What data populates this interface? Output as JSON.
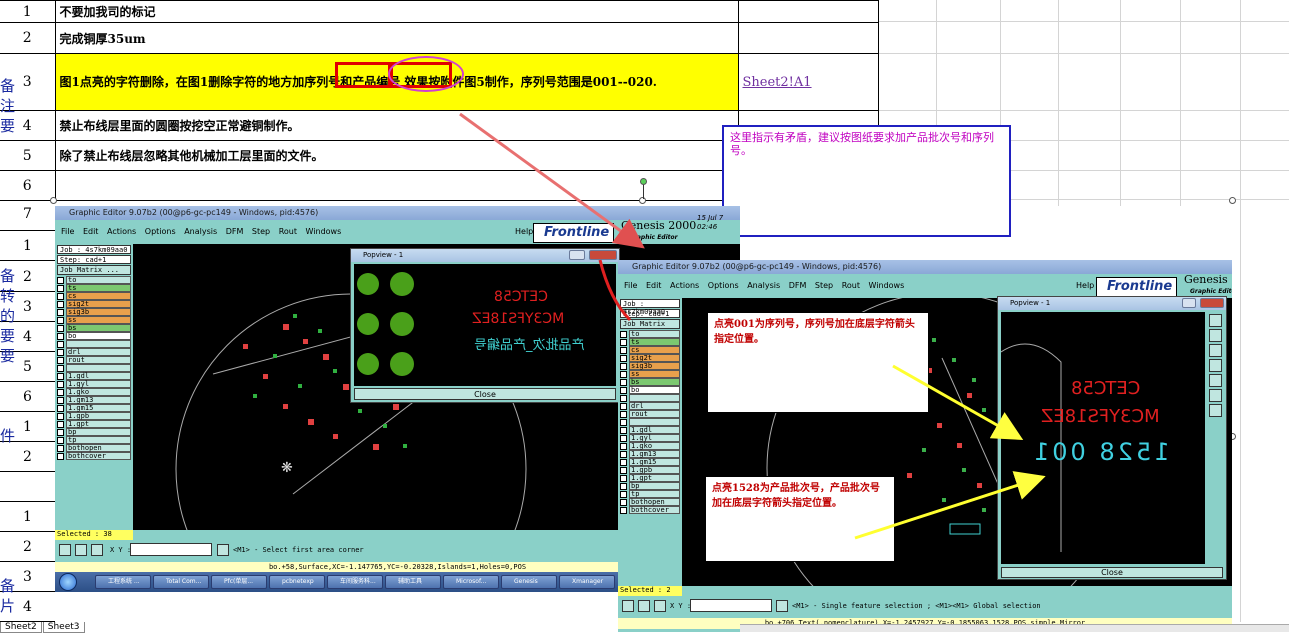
{
  "sheet": {
    "rows": [
      {
        "num": "1",
        "text": "不要加我司的标记",
        "link": ""
      },
      {
        "num": "2",
        "text": "完成铜厚35um",
        "link": ""
      },
      {
        "num": "3",
        "text": "图1点亮的字符删除，在图1删除字符的地方加序列号和产品编号 效果按附件图5制作，序列号范围是001--020.",
        "link": "Sheet2!A1",
        "highlight": true
      },
      {
        "num": "4",
        "text": "禁止布线层里面的圆圈按挖空正常避铜制作。",
        "link": ""
      },
      {
        "num": "5",
        "text": "除了禁止布线层忽略其他机械加工层里面的文件。",
        "link": ""
      },
      {
        "num": "6",
        "text": "",
        "link": ""
      },
      {
        "num": "7",
        "text": "",
        "link": ""
      }
    ],
    "lower_row_numbers": [
      "1",
      "2",
      "3",
      "4",
      "5",
      "6",
      "1",
      "2",
      "",
      "1",
      "2",
      "3",
      "4"
    ],
    "side_chars": [
      "备",
      "注",
      "要",
      "备",
      "转",
      "的",
      "要",
      "要",
      "件",
      "备",
      "片"
    ],
    "tabs": [
      "Sheet2",
      "Sheet3"
    ]
  },
  "comment": {
    "text": "这里指示有矛盾，建议按图纸要求加产品批次号和序列号。"
  },
  "win1": {
    "title": "Graphic Editor 9.07b2 (00@p6-gc-pc149 - Windows, pid:4576)",
    "menu": [
      "File",
      "Edit",
      "Actions",
      "Options",
      "Analysis",
      "DFM",
      "Step",
      "Rout",
      "Windows"
    ],
    "help": "Help",
    "logo": "Frontline",
    "app_name": "Genesis 2000",
    "app_sub": "Graphic Editor",
    "clock": "15 Jul 7 02:46",
    "job": "Job : 4s7km09aa0",
    "step": "Step: cad+1",
    "job_matrix": "Job Matrix ...",
    "layers": [
      {
        "name": "to",
        "style": ""
      },
      {
        "name": "ts",
        "style": "gr"
      },
      {
        "name": "cs",
        "style": "or"
      },
      {
        "name": "sig2t",
        "style": "or"
      },
      {
        "name": "sig3b",
        "style": "or"
      },
      {
        "name": "ss",
        "style": "or"
      },
      {
        "name": "bs",
        "style": "gr"
      },
      {
        "name": "bo",
        "style": "hi"
      },
      {
        "name": "",
        "style": ""
      },
      {
        "name": "drl",
        "style": ""
      },
      {
        "name": "rout",
        "style": ""
      },
      {
        "name": "",
        "style": ""
      },
      {
        "name": "1.gdl",
        "style": ""
      },
      {
        "name": "1.gyl",
        "style": ""
      },
      {
        "name": "1.gko",
        "style": ""
      },
      {
        "name": "1.gm13",
        "style": ""
      },
      {
        "name": "1.gm15",
        "style": ""
      },
      {
        "name": "1.gpb",
        "style": ""
      },
      {
        "name": "1.gpt",
        "style": ""
      },
      {
        "name": "bp",
        "style": ""
      },
      {
        "name": "tp",
        "style": ""
      },
      {
        "name": "bothopen",
        "style": ""
      },
      {
        "name": "bothcover",
        "style": ""
      }
    ],
    "selected": "Selected : 38",
    "xy_label": "X Y :",
    "hint": "<M1> - Select first area corner",
    "info": "bo.+58,Surface,XC=-1.147765,YC=-0.20328,Islands=1,Holes=0,POS"
  },
  "popview1": {
    "title": "Popview - 1",
    "text_lines": [
      "CETC58",
      "MC3YFS18EZ",
      "产品批次_产品编号"
    ],
    "close": "Close"
  },
  "win2": {
    "title": "Graphic Editor 9.07b2 (00@p6-gc-pc149 - Windows, pid:4576)",
    "menu": [
      "File",
      "Edit",
      "Actions",
      "Options",
      "Analysis",
      "DFM",
      "Step",
      "Rout",
      "Windows"
    ],
    "help": "Help",
    "logo": "Frontline",
    "app_name": "Genesis 20",
    "app_sub": "Graphic Editor",
    "job": "Job : 4s7km09aa0",
    "step": "Step: cad+1",
    "job_matrix": "Job Matrix ...",
    "layers": [
      {
        "name": "to",
        "style": ""
      },
      {
        "name": "ts",
        "style": "gr"
      },
      {
        "name": "cs",
        "style": "or"
      },
      {
        "name": "sig2t",
        "style": "or"
      },
      {
        "name": "sig3b",
        "style": "or"
      },
      {
        "name": "ss",
        "style": "or"
      },
      {
        "name": "bs",
        "style": "gr"
      },
      {
        "name": "bo",
        "style": "hi"
      },
      {
        "name": "",
        "style": ""
      },
      {
        "name": "drl",
        "style": ""
      },
      {
        "name": "rout",
        "style": ""
      },
      {
        "name": "",
        "style": ""
      },
      {
        "name": "1.gdl",
        "style": ""
      },
      {
        "name": "1.gyl",
        "style": ""
      },
      {
        "name": "1.gko",
        "style": ""
      },
      {
        "name": "1.gm13",
        "style": ""
      },
      {
        "name": "1.gm15",
        "style": ""
      },
      {
        "name": "1.gpb",
        "style": ""
      },
      {
        "name": "1.gpt",
        "style": ""
      },
      {
        "name": "bp",
        "style": ""
      },
      {
        "name": "tp",
        "style": ""
      },
      {
        "name": "bothopen",
        "style": ""
      },
      {
        "name": "bothcover",
        "style": ""
      }
    ],
    "selected": "Selected : 2",
    "xy_label": "X Y :",
    "hint": "<M1> - Single feature selection ; <M1><M1> Global selection",
    "info": "bo.+706.Text(.nomenclature).X=-1.2457927.Y=-0.1855063.1528.POS.simple.Mirror"
  },
  "popview2": {
    "title": "Popview - 1",
    "text_lines": [
      "CETC58",
      "MC3YFS18EZ",
      "1528 001"
    ],
    "close": "Close"
  },
  "notes": {
    "serial": "点亮001为序列号，序列号加在底层字符箭头指定位置。",
    "batch": "点亮1528为产品批次号，产品批次号加在底层字符箭头指定位置。"
  },
  "taskbar": {
    "items": [
      "工程系统 ...",
      "Total Com...",
      "Pfc(单层...",
      "pcbnetexp",
      "车间服务科...",
      "辅助工具",
      "Microsof...",
      "Genesis",
      "Xmanager"
    ]
  }
}
